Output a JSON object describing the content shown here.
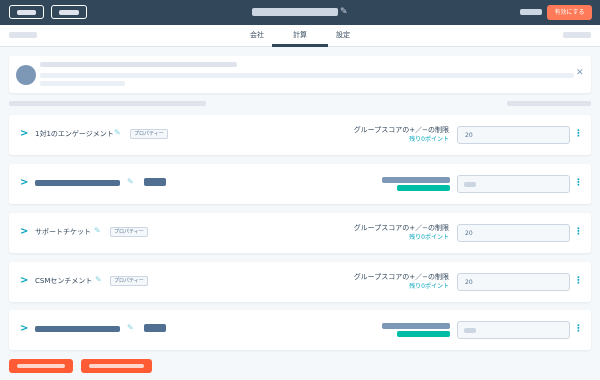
{
  "header": {
    "enable_button": "有効にする",
    "title_icon": "pencil-icon"
  },
  "tabs": [
    {
      "label": "会社",
      "active": false
    },
    {
      "label": "計算",
      "active": true
    },
    {
      "label": "設定",
      "active": false
    }
  ],
  "info_card": {
    "close_icon": "close-icon"
  },
  "rows": [
    {
      "label": "1対1のエンゲージメント",
      "tag": "プロパティー",
      "limit_title": "グループスコアの+／−の制限",
      "limit_sub": "残り0ポイント",
      "value": "20"
    },
    {
      "label": "サポートチケット",
      "tag": "プロパティー",
      "limit_title": "グループスコアの+／−の制限",
      "limit_sub": "残り0ポイント",
      "value": "20"
    },
    {
      "label": "CSMセンチメント",
      "tag": "プロパティー",
      "limit_title": "グループスコアの+／−の制限",
      "limit_sub": "残り0ポイント",
      "value": "20"
    }
  ],
  "icons": {
    "expand": "chevron-right-icon",
    "edit": "pencil-icon",
    "more": "kebab-menu-icon"
  },
  "colors": {
    "header_bg": "#33475b",
    "accent_orange": "#ff7a59",
    "accent_teal": "#00a4bd",
    "positive_green": "#00bda5"
  }
}
